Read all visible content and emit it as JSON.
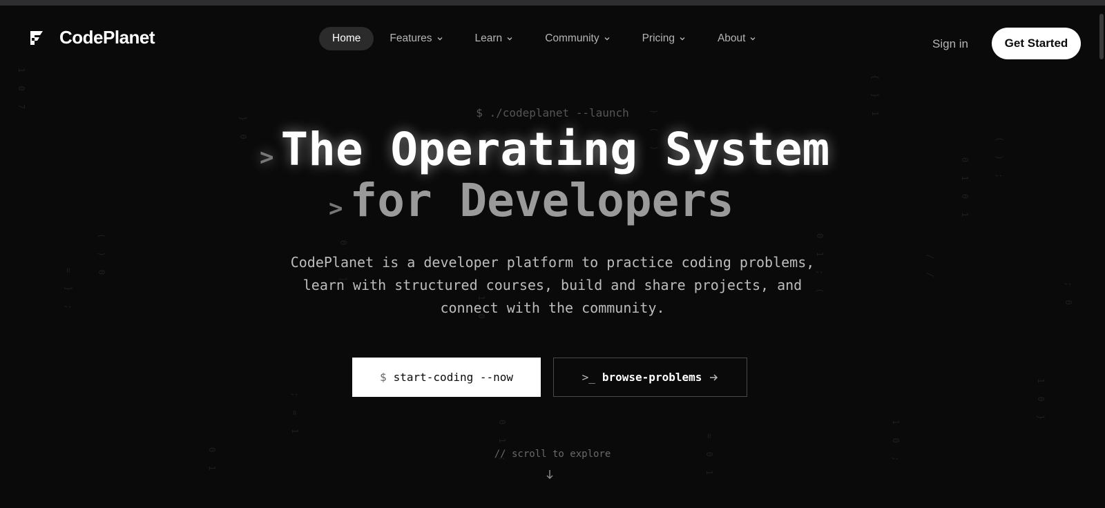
{
  "brand": {
    "name": "CodePlanet",
    "logo_icon": "codeplanet-logo-icon"
  },
  "nav": {
    "items": [
      {
        "label": "Home",
        "active": true
      },
      {
        "label": "Features",
        "dropdown": true
      },
      {
        "label": "Learn",
        "dropdown": true
      },
      {
        "label": "Community",
        "dropdown": true
      },
      {
        "label": "Pricing",
        "dropdown": true
      },
      {
        "label": "About",
        "dropdown": true
      }
    ],
    "sign_in": "Sign in",
    "get_started": "Get Started"
  },
  "hero": {
    "command": "$ ./codeplanet --launch",
    "prompt_symbol": ">",
    "title_line1": "The Operating System",
    "title_line2": "for Developers",
    "description": "CodePlanet is a developer platform to practice coding problems, learn with structured courses, build and share projects, and connect with the community.",
    "primary_cta": {
      "prefix": "$",
      "label": "start-coding --now"
    },
    "secondary_cta": {
      "prefix": ">_",
      "label": "browse-problems",
      "icon": "arrow-right-icon"
    },
    "scroll_hint": "// scroll to explore",
    "scroll_icon": "arrow-down-icon"
  },
  "colors": {
    "background": "#0a0a0a",
    "text_primary": "#ffffff",
    "text_muted": "#b5b5b5",
    "pill_active": "#2b2b2b"
  }
}
